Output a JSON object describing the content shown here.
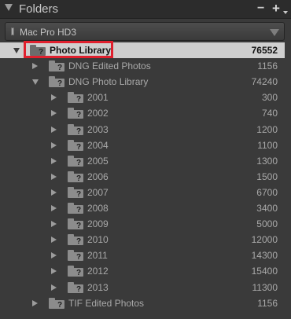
{
  "header": {
    "title": "Folders",
    "minus_label": "−",
    "plus_label": "+"
  },
  "volume": {
    "name": "Mac Pro HD3"
  },
  "rows": [
    {
      "label": "Photo Library",
      "count": "76552",
      "level": 0,
      "expanded": true,
      "selected": true
    },
    {
      "label": "DNG Edited Photos",
      "count": "1156",
      "level": 1,
      "expanded": false
    },
    {
      "label": "DNG Photo Library",
      "count": "74240",
      "level": 1,
      "expanded": true
    },
    {
      "label": "2001",
      "count": "300",
      "level": 2,
      "expanded": false
    },
    {
      "label": "2002",
      "count": "740",
      "level": 2,
      "expanded": false
    },
    {
      "label": "2003",
      "count": "1200",
      "level": 2,
      "expanded": false
    },
    {
      "label": "2004",
      "count": "1100",
      "level": 2,
      "expanded": false
    },
    {
      "label": "2005",
      "count": "1300",
      "level": 2,
      "expanded": false
    },
    {
      "label": "2006",
      "count": "1500",
      "level": 2,
      "expanded": false
    },
    {
      "label": "2007",
      "count": "6700",
      "level": 2,
      "expanded": false
    },
    {
      "label": "2008",
      "count": "3400",
      "level": 2,
      "expanded": false
    },
    {
      "label": "2009",
      "count": "5000",
      "level": 2,
      "expanded": false
    },
    {
      "label": "2010",
      "count": "12000",
      "level": 2,
      "expanded": false
    },
    {
      "label": "2011",
      "count": "14300",
      "level": 2,
      "expanded": false
    },
    {
      "label": "2012",
      "count": "15400",
      "level": 2,
      "expanded": false
    },
    {
      "label": "2013",
      "count": "11300",
      "level": 2,
      "expanded": false
    },
    {
      "label": "TIF Edited Photos",
      "count": "1156",
      "level": 1,
      "expanded": false
    }
  ],
  "colors": {
    "highlight": "#e0202e",
    "selected_row": "#cfcfcf",
    "panel_bg": "#3a3a3a"
  }
}
